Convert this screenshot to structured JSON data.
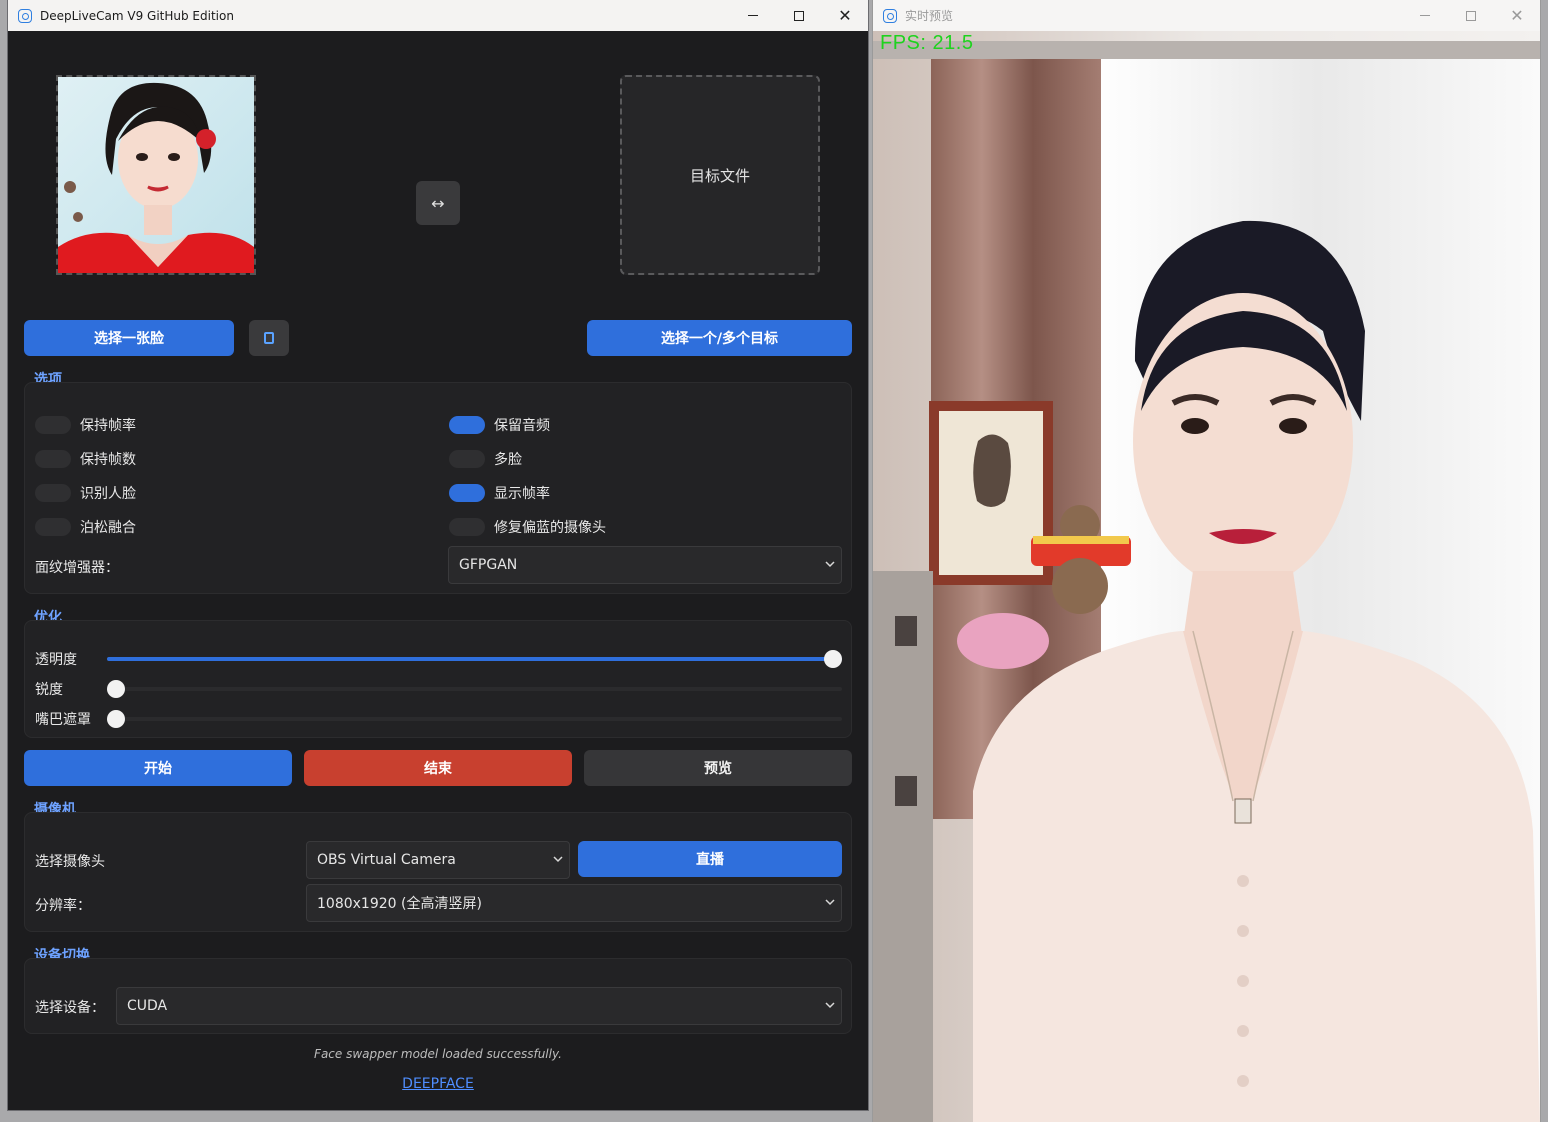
{
  "main_window": {
    "title": "DeepLiveCam V9 GitHub Edition",
    "controls": {
      "minimize": "—",
      "maximize": "□",
      "close": "✕"
    }
  },
  "source": {
    "swap_label": "↔",
    "target_placeholder": "目标文件"
  },
  "buttons": {
    "select_face": "选择一张脸",
    "select_target": "选择一个/多个目标",
    "start": "开始",
    "stop": "结束",
    "preview": "预览",
    "live": "直播"
  },
  "options": {
    "section": "选项",
    "toggles": [
      {
        "label": "保持帧率",
        "on": false
      },
      {
        "label": "保持帧数",
        "on": false
      },
      {
        "label": "识别人脸",
        "on": false
      },
      {
        "label": "泊松融合",
        "on": false
      },
      {
        "label": "保留音频",
        "on": true
      },
      {
        "label": "多脸",
        "on": false
      },
      {
        "label": "显示帧率",
        "on": true
      },
      {
        "label": "修复偏蓝的摄像头",
        "on": false
      }
    ],
    "enhancer_label": "面纹增强器：",
    "enhancer_value": "GFPGAN"
  },
  "optimize": {
    "section": "优化",
    "sliders": [
      {
        "label": "透明度",
        "value": 1.0
      },
      {
        "label": "锐度",
        "value": 0.0
      },
      {
        "label": "嘴巴遮罩",
        "value": 0.0
      }
    ]
  },
  "camera": {
    "section": "摄像机",
    "select_label": "选择摄像头",
    "camera_value": "OBS Virtual Camera",
    "resolution_label": "分辨率：",
    "resolution_value": "1080x1920 (全高清竖屏)"
  },
  "device": {
    "section": "设备切换",
    "select_label": "选择设备：",
    "device_value": "CUDA"
  },
  "status": "Face swapper model loaded successfully.",
  "footer_link": "DEEPFACE",
  "preview_window": {
    "title": "实时预览",
    "fps_text": "FPS:  21.5"
  },
  "colors": {
    "accent": "#2f6fdc",
    "stop": "#c8402f",
    "section": "#6ea2ff",
    "fps": "#1ed31e"
  }
}
